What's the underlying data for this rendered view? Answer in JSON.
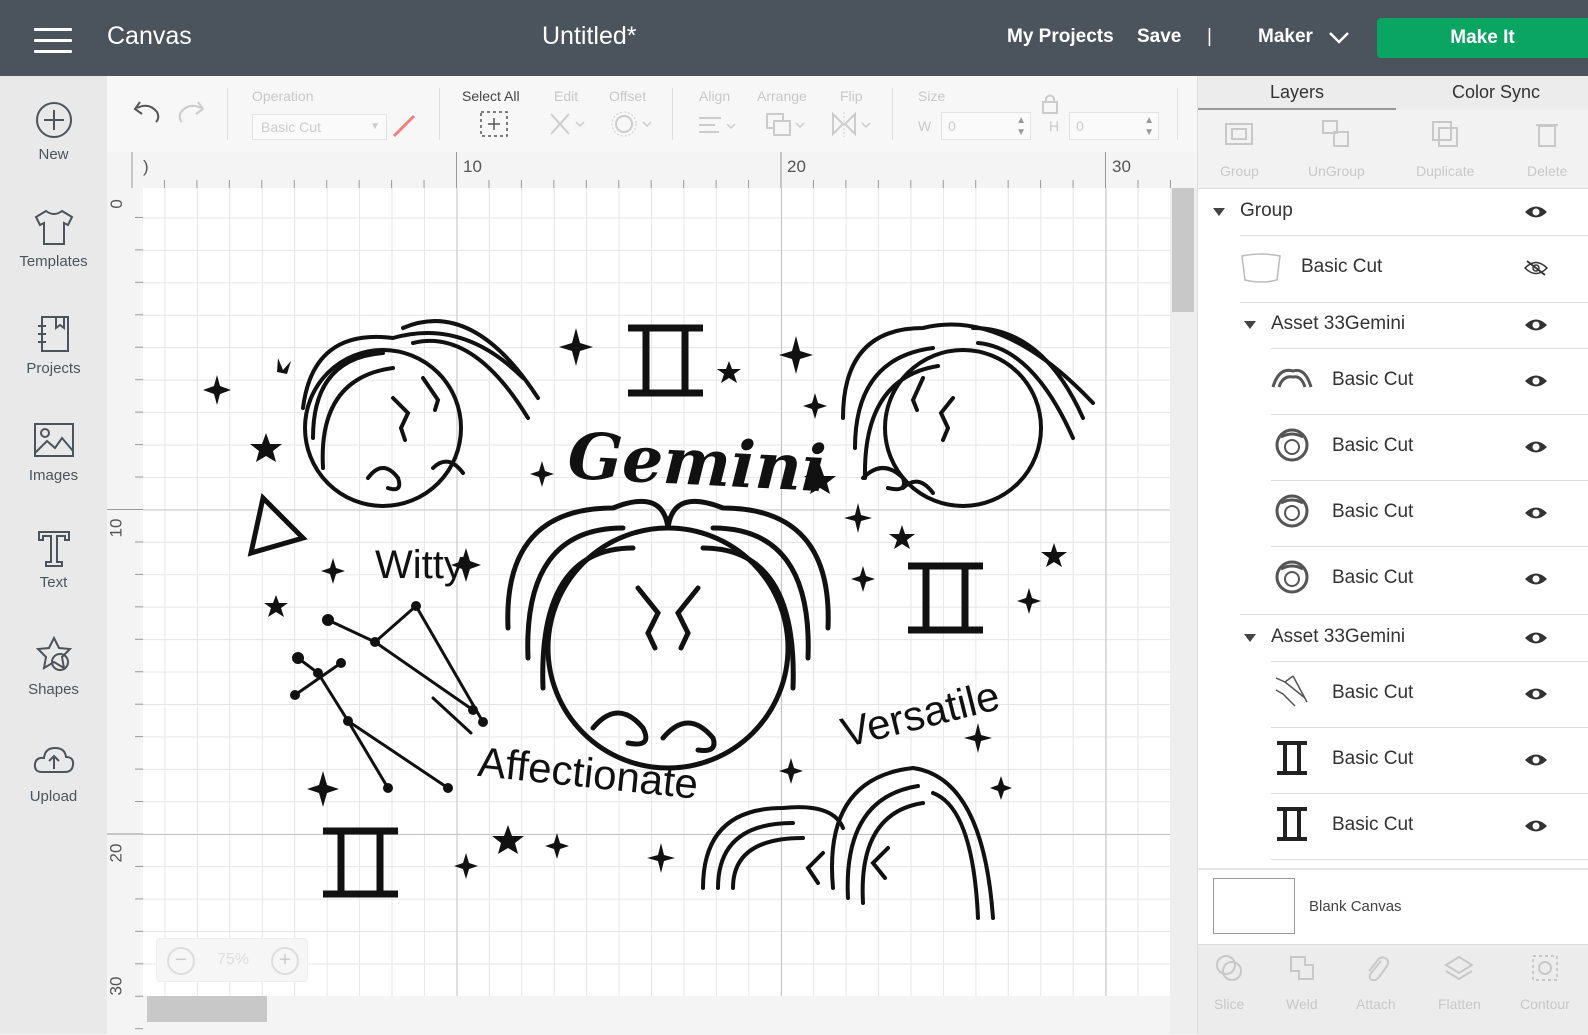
{
  "header": {
    "app_title": "Canvas",
    "doc_title": "Untitled*",
    "my_projects": "My Projects",
    "save": "Save",
    "separator": "|",
    "machine": "Maker",
    "make_it": "Make It",
    "colors": {
      "bar": "#4b545c",
      "make_it": "#0aa562"
    }
  },
  "sidebar": {
    "items": [
      {
        "label": "New",
        "icon": "plus-circle-icon"
      },
      {
        "label": "Templates",
        "icon": "tshirt-icon"
      },
      {
        "label": "Projects",
        "icon": "notebook-icon"
      },
      {
        "label": "Images",
        "icon": "image-icon"
      },
      {
        "label": "Text",
        "icon": "text-icon"
      },
      {
        "label": "Shapes",
        "icon": "shapes-icon"
      },
      {
        "label": "Upload",
        "icon": "cloud-upload-icon"
      }
    ]
  },
  "toolbar": {
    "operation_label": "Operation",
    "operation_value": "Basic Cut",
    "select_all": "Select All",
    "edit": "Edit",
    "offset": "Offset",
    "align": "Align",
    "arrange": "Arrange",
    "flip": "Flip",
    "size": "Size",
    "w_label": "W",
    "w_value": "0",
    "h_label": "H",
    "h_value": "0"
  },
  "rulers": {
    "top": [
      ")",
      "10",
      "20",
      "30"
    ],
    "left": [
      "0",
      "10",
      "20",
      "30"
    ]
  },
  "canvas": {
    "words": [
      "Gemini",
      "Witty",
      "Versatile",
      "Affectionate"
    ],
    "zoom": "75%",
    "zoom_minus": "−",
    "zoom_plus": "+"
  },
  "layers_panel": {
    "tabs": [
      "Layers",
      "Color Sync"
    ],
    "actions": [
      "Group",
      "UnGroup",
      "Duplicate",
      "Delete"
    ],
    "rows": [
      {
        "label": "Group",
        "kind": "group",
        "visible": true
      },
      {
        "label": "Basic Cut",
        "kind": "item",
        "visible": false,
        "thumb": "blank-shape"
      },
      {
        "label": "Asset 33Gemini",
        "kind": "subgroup",
        "visible": true
      },
      {
        "label": "Basic Cut",
        "kind": "subitem",
        "visible": true,
        "thumb": "hair-icon"
      },
      {
        "label": "Basic Cut",
        "kind": "subitem",
        "visible": true,
        "thumb": "faces-icon"
      },
      {
        "label": "Basic Cut",
        "kind": "subitem",
        "visible": true,
        "thumb": "faces-icon"
      },
      {
        "label": "Basic Cut",
        "kind": "subitem",
        "visible": true,
        "thumb": "faces-icon"
      },
      {
        "label": "Asset 33Gemini",
        "kind": "subgroup",
        "visible": true
      },
      {
        "label": "Basic Cut",
        "kind": "subitem",
        "visible": true,
        "thumb": "constellation-icon"
      },
      {
        "label": "Basic Cut",
        "kind": "subitem",
        "visible": true,
        "thumb": "gemini-symbol-icon"
      },
      {
        "label": "Basic Cut",
        "kind": "subitem",
        "visible": true,
        "thumb": "gemini-symbol-icon"
      }
    ],
    "blank_canvas": "Blank Canvas",
    "bottom_actions": [
      "Slice",
      "Weld",
      "Attach",
      "Flatten",
      "Contour"
    ]
  }
}
